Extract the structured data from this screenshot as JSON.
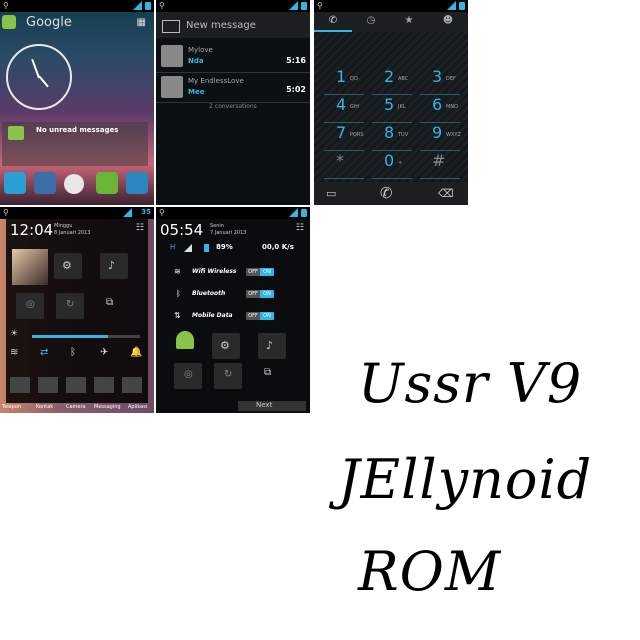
{
  "home": {
    "search_label": "Google",
    "widget_text": "No unread messages",
    "colors": {
      "bg_top": "#0f3b4a",
      "bg_mid": "#5b3b6a",
      "bg_low": "#c9667a",
      "accent": "#33b5e5"
    }
  },
  "messaging": {
    "title": "New message",
    "threads": [
      {
        "name": "Mylove",
        "preview": "Nda",
        "time": "5:16"
      },
      {
        "name": "My EndlessLove",
        "preview": "Mee",
        "time": "5:02"
      }
    ],
    "footer": "2 conversations"
  },
  "dialer": {
    "keys": [
      {
        "digit": "1",
        "sub": "QO"
      },
      {
        "digit": "2",
        "sub": "ABC"
      },
      {
        "digit": "3",
        "sub": "DEF"
      },
      {
        "digit": "4",
        "sub": "GHI"
      },
      {
        "digit": "5",
        "sub": "JKL"
      },
      {
        "digit": "6",
        "sub": "MNO"
      },
      {
        "digit": "7",
        "sub": "PQRS"
      },
      {
        "digit": "8",
        "sub": "TUV"
      },
      {
        "digit": "9",
        "sub": "WXYZ"
      },
      {
        "digit": "*",
        "sub": ""
      },
      {
        "digit": "0",
        "sub": "+"
      },
      {
        "digit": "#",
        "sub": ""
      }
    ]
  },
  "notif1": {
    "time": "12:04",
    "day": "Minggu",
    "date": "8 Januari 2013",
    "battery": "35",
    "brightness_level": 0.7,
    "dock_labels": [
      "Telepon",
      "Kontak",
      "Camera",
      "Messaging",
      "Aplikasi"
    ]
  },
  "notif2": {
    "time": "05:54",
    "day": "Senin",
    "date": "7 Januari 2013",
    "battery_pct": "89%",
    "net_speed": "00,0 K/s",
    "toggles": [
      {
        "label": "Wifi Wireless",
        "off": "OFF",
        "on": "ON"
      },
      {
        "label": "Bluetooth",
        "off": "OFF",
        "on": "ON"
      },
      {
        "label": "Mobile Data",
        "off": "OFF",
        "on": "ON"
      }
    ],
    "next_label": "Next"
  },
  "title_lines": [
    "Ussr V9",
    "JEllynoid",
    "ROM"
  ]
}
